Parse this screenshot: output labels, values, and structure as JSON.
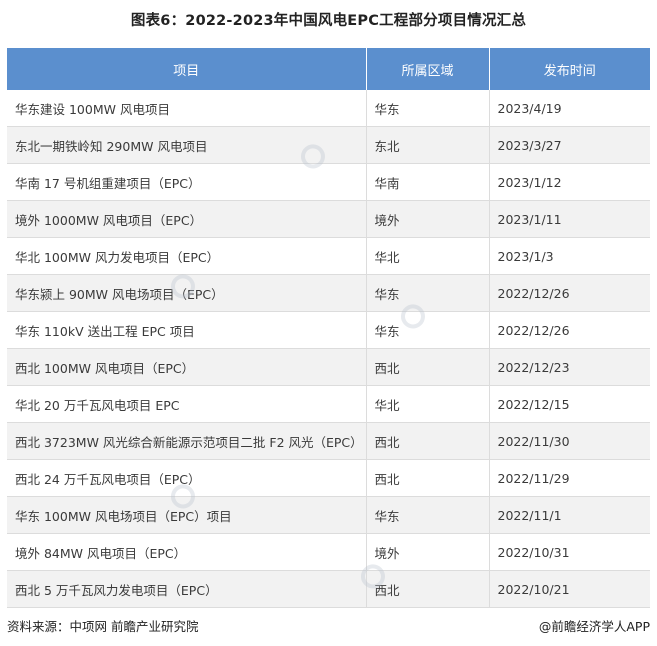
{
  "title": "图表6：2022-2023年中国风电EPC工程部分项目情况汇总",
  "chart_data": {
    "type": "table",
    "columns": [
      "项目",
      "所属区域",
      "发布时间"
    ],
    "rows": [
      [
        "华东建设 100MW 风电项目",
        "华东",
        "2023/4/19"
      ],
      [
        "东北一期铁岭知 290MW 风电项目",
        "东北",
        "2023/3/27"
      ],
      [
        "华南 17 号机组重建项目（EPC）",
        "华南",
        "2023/1/12"
      ],
      [
        "境外 1000MW 风电项目（EPC）",
        "境外",
        "2023/1/11"
      ],
      [
        "华北 100MW 风力发电项目（EPC）",
        "华北",
        "2023/1/3"
      ],
      [
        "华东颍上 90MW 风电场项目（EPC）",
        "华东",
        "2022/12/26"
      ],
      [
        "华东 110kV 送出工程 EPC 项目",
        "华东",
        "2022/12/26"
      ],
      [
        "西北 100MW 风电项目（EPC）",
        "西北",
        "2022/12/23"
      ],
      [
        "华北 20 万千瓦风电项目 EPC",
        "华北",
        "2022/12/15"
      ],
      [
        "西北 3723MW 风光综合新能源示范项目二批 F2 风光（EPC）",
        "西北",
        "2022/11/30"
      ],
      [
        "西北 24 万千瓦风电项目（EPC）",
        "西北",
        "2022/11/29"
      ],
      [
        "华东 100MW 风电场项目（EPC）项目",
        "华东",
        "2022/11/1"
      ],
      [
        "境外 84MW 风电项目（EPC）",
        "境外",
        "2022/10/31"
      ],
      [
        "西北 5 万千瓦风力发电项目（EPC）",
        "西北",
        "2022/10/21"
      ]
    ]
  },
  "footer": {
    "source": "资料来源：中项网 前瞻产业研究院",
    "brand": "@前瞻经济学人APP"
  },
  "colors": {
    "header_bg": "#5b8fce",
    "header_text": "#ffffff",
    "stripe_bg": "#f2f2f2"
  }
}
